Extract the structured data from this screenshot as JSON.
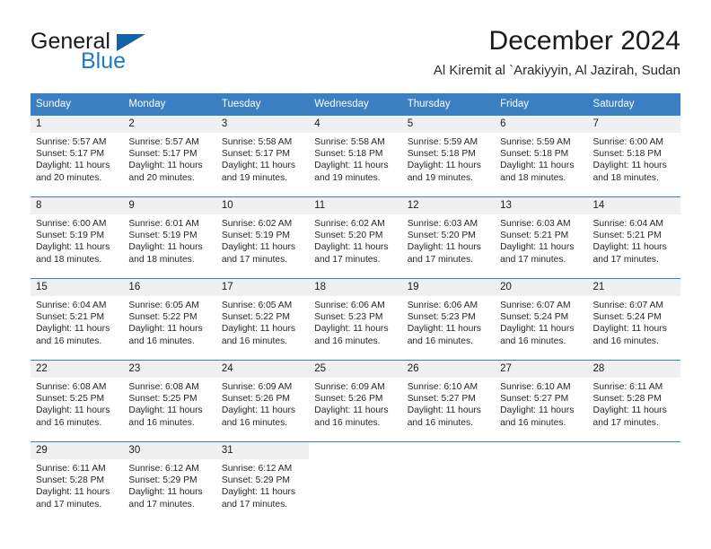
{
  "brand": {
    "name_part1": "General",
    "name_part2": "Blue",
    "flag_icon": "flag-triangle-icon",
    "accent_color": "#1f7ac4",
    "flag_color": "#1464a5"
  },
  "header": {
    "title": "December 2024",
    "subtitle": "Al Kiremit al `Arakiyyin, Al Jazirah, Sudan"
  },
  "calendar": {
    "header_bg": "#3a7fc1",
    "daynum_bg": "#f0f0f0",
    "weekdays": [
      "Sunday",
      "Monday",
      "Tuesday",
      "Wednesday",
      "Thursday",
      "Friday",
      "Saturday"
    ],
    "weeks": [
      [
        {
          "day": "1",
          "sunrise": "Sunrise: 5:57 AM",
          "sunset": "Sunset: 5:17 PM",
          "daylight1": "Daylight: 11 hours",
          "daylight2": "and 20 minutes."
        },
        {
          "day": "2",
          "sunrise": "Sunrise: 5:57 AM",
          "sunset": "Sunset: 5:17 PM",
          "daylight1": "Daylight: 11 hours",
          "daylight2": "and 20 minutes."
        },
        {
          "day": "3",
          "sunrise": "Sunrise: 5:58 AM",
          "sunset": "Sunset: 5:17 PM",
          "daylight1": "Daylight: 11 hours",
          "daylight2": "and 19 minutes."
        },
        {
          "day": "4",
          "sunrise": "Sunrise: 5:58 AM",
          "sunset": "Sunset: 5:18 PM",
          "daylight1": "Daylight: 11 hours",
          "daylight2": "and 19 minutes."
        },
        {
          "day": "5",
          "sunrise": "Sunrise: 5:59 AM",
          "sunset": "Sunset: 5:18 PM",
          "daylight1": "Daylight: 11 hours",
          "daylight2": "and 19 minutes."
        },
        {
          "day": "6",
          "sunrise": "Sunrise: 5:59 AM",
          "sunset": "Sunset: 5:18 PM",
          "daylight1": "Daylight: 11 hours",
          "daylight2": "and 18 minutes."
        },
        {
          "day": "7",
          "sunrise": "Sunrise: 6:00 AM",
          "sunset": "Sunset: 5:18 PM",
          "daylight1": "Daylight: 11 hours",
          "daylight2": "and 18 minutes."
        }
      ],
      [
        {
          "day": "8",
          "sunrise": "Sunrise: 6:00 AM",
          "sunset": "Sunset: 5:19 PM",
          "daylight1": "Daylight: 11 hours",
          "daylight2": "and 18 minutes."
        },
        {
          "day": "9",
          "sunrise": "Sunrise: 6:01 AM",
          "sunset": "Sunset: 5:19 PM",
          "daylight1": "Daylight: 11 hours",
          "daylight2": "and 18 minutes."
        },
        {
          "day": "10",
          "sunrise": "Sunrise: 6:02 AM",
          "sunset": "Sunset: 5:19 PM",
          "daylight1": "Daylight: 11 hours",
          "daylight2": "and 17 minutes."
        },
        {
          "day": "11",
          "sunrise": "Sunrise: 6:02 AM",
          "sunset": "Sunset: 5:20 PM",
          "daylight1": "Daylight: 11 hours",
          "daylight2": "and 17 minutes."
        },
        {
          "day": "12",
          "sunrise": "Sunrise: 6:03 AM",
          "sunset": "Sunset: 5:20 PM",
          "daylight1": "Daylight: 11 hours",
          "daylight2": "and 17 minutes."
        },
        {
          "day": "13",
          "sunrise": "Sunrise: 6:03 AM",
          "sunset": "Sunset: 5:21 PM",
          "daylight1": "Daylight: 11 hours",
          "daylight2": "and 17 minutes."
        },
        {
          "day": "14",
          "sunrise": "Sunrise: 6:04 AM",
          "sunset": "Sunset: 5:21 PM",
          "daylight1": "Daylight: 11 hours",
          "daylight2": "and 17 minutes."
        }
      ],
      [
        {
          "day": "15",
          "sunrise": "Sunrise: 6:04 AM",
          "sunset": "Sunset: 5:21 PM",
          "daylight1": "Daylight: 11 hours",
          "daylight2": "and 16 minutes."
        },
        {
          "day": "16",
          "sunrise": "Sunrise: 6:05 AM",
          "sunset": "Sunset: 5:22 PM",
          "daylight1": "Daylight: 11 hours",
          "daylight2": "and 16 minutes."
        },
        {
          "day": "17",
          "sunrise": "Sunrise: 6:05 AM",
          "sunset": "Sunset: 5:22 PM",
          "daylight1": "Daylight: 11 hours",
          "daylight2": "and 16 minutes."
        },
        {
          "day": "18",
          "sunrise": "Sunrise: 6:06 AM",
          "sunset": "Sunset: 5:23 PM",
          "daylight1": "Daylight: 11 hours",
          "daylight2": "and 16 minutes."
        },
        {
          "day": "19",
          "sunrise": "Sunrise: 6:06 AM",
          "sunset": "Sunset: 5:23 PM",
          "daylight1": "Daylight: 11 hours",
          "daylight2": "and 16 minutes."
        },
        {
          "day": "20",
          "sunrise": "Sunrise: 6:07 AM",
          "sunset": "Sunset: 5:24 PM",
          "daylight1": "Daylight: 11 hours",
          "daylight2": "and 16 minutes."
        },
        {
          "day": "21",
          "sunrise": "Sunrise: 6:07 AM",
          "sunset": "Sunset: 5:24 PM",
          "daylight1": "Daylight: 11 hours",
          "daylight2": "and 16 minutes."
        }
      ],
      [
        {
          "day": "22",
          "sunrise": "Sunrise: 6:08 AM",
          "sunset": "Sunset: 5:25 PM",
          "daylight1": "Daylight: 11 hours",
          "daylight2": "and 16 minutes."
        },
        {
          "day": "23",
          "sunrise": "Sunrise: 6:08 AM",
          "sunset": "Sunset: 5:25 PM",
          "daylight1": "Daylight: 11 hours",
          "daylight2": "and 16 minutes."
        },
        {
          "day": "24",
          "sunrise": "Sunrise: 6:09 AM",
          "sunset": "Sunset: 5:26 PM",
          "daylight1": "Daylight: 11 hours",
          "daylight2": "and 16 minutes."
        },
        {
          "day": "25",
          "sunrise": "Sunrise: 6:09 AM",
          "sunset": "Sunset: 5:26 PM",
          "daylight1": "Daylight: 11 hours",
          "daylight2": "and 16 minutes."
        },
        {
          "day": "26",
          "sunrise": "Sunrise: 6:10 AM",
          "sunset": "Sunset: 5:27 PM",
          "daylight1": "Daylight: 11 hours",
          "daylight2": "and 16 minutes."
        },
        {
          "day": "27",
          "sunrise": "Sunrise: 6:10 AM",
          "sunset": "Sunset: 5:27 PM",
          "daylight1": "Daylight: 11 hours",
          "daylight2": "and 16 minutes."
        },
        {
          "day": "28",
          "sunrise": "Sunrise: 6:11 AM",
          "sunset": "Sunset: 5:28 PM",
          "daylight1": "Daylight: 11 hours",
          "daylight2": "and 17 minutes."
        }
      ],
      [
        {
          "day": "29",
          "sunrise": "Sunrise: 6:11 AM",
          "sunset": "Sunset: 5:28 PM",
          "daylight1": "Daylight: 11 hours",
          "daylight2": "and 17 minutes."
        },
        {
          "day": "30",
          "sunrise": "Sunrise: 6:12 AM",
          "sunset": "Sunset: 5:29 PM",
          "daylight1": "Daylight: 11 hours",
          "daylight2": "and 17 minutes."
        },
        {
          "day": "31",
          "sunrise": "Sunrise: 6:12 AM",
          "sunset": "Sunset: 5:29 PM",
          "daylight1": "Daylight: 11 hours",
          "daylight2": "and 17 minutes."
        },
        {
          "day": "",
          "sunrise": "",
          "sunset": "",
          "daylight1": "",
          "daylight2": ""
        },
        {
          "day": "",
          "sunrise": "",
          "sunset": "",
          "daylight1": "",
          "daylight2": ""
        },
        {
          "day": "",
          "sunrise": "",
          "sunset": "",
          "daylight1": "",
          "daylight2": ""
        },
        {
          "day": "",
          "sunrise": "",
          "sunset": "",
          "daylight1": "",
          "daylight2": ""
        }
      ]
    ]
  }
}
